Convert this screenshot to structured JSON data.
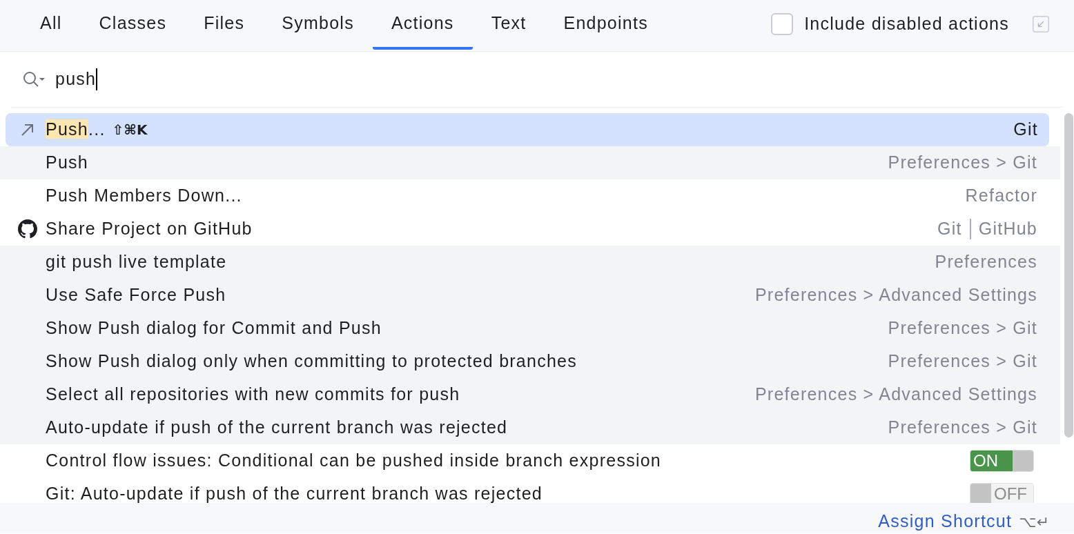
{
  "tabs": [
    {
      "label": "All",
      "selected": false
    },
    {
      "label": "Classes",
      "selected": false
    },
    {
      "label": "Files",
      "selected": false
    },
    {
      "label": "Symbols",
      "selected": false
    },
    {
      "label": "Actions",
      "selected": true
    },
    {
      "label": "Text",
      "selected": false
    },
    {
      "label": "Endpoints",
      "selected": false
    }
  ],
  "include_disabled": {
    "label": "Include disabled actions",
    "checked": false
  },
  "search": {
    "value": "push"
  },
  "results": [
    {
      "kind": "action",
      "label_parts": [
        {
          "text": "Push",
          "highlighted": true
        },
        {
          "text": "...",
          "highlighted": false
        }
      ],
      "shortcut": "⇧⌘K",
      "location": [
        "Git"
      ],
      "selected": true
    },
    {
      "kind": "action",
      "label": "Push",
      "location": [
        "Preferences > Git"
      ],
      "selected": false,
      "shaded": true
    },
    {
      "kind": "action",
      "label": "Push Members Down...",
      "location": [
        "Refactor"
      ],
      "selected": false,
      "shaded": false
    },
    {
      "kind": "action",
      "label": "Share Project on GitHub",
      "location": [
        "Git",
        "GitHub"
      ],
      "selected": false,
      "shaded": false
    },
    {
      "kind": "action",
      "label": "git push live template",
      "location": [
        "Preferences"
      ],
      "selected": false,
      "shaded": true
    },
    {
      "kind": "action",
      "label": "Use Safe Force Push",
      "location": [
        "Preferences > Advanced Settings"
      ],
      "selected": false,
      "shaded": true
    },
    {
      "kind": "action",
      "label": "Show Push dialog for Commit and Push",
      "location": [
        "Preferences > Git"
      ],
      "selected": false,
      "shaded": true
    },
    {
      "kind": "action",
      "label": "Show Push dialog only when committing to protected branches",
      "location": [
        "Preferences > Git"
      ],
      "selected": false,
      "shaded": true
    },
    {
      "kind": "action",
      "label": "Select all repositories with new commits for push",
      "location": [
        "Preferences > Advanced Settings"
      ],
      "selected": false,
      "shaded": true
    },
    {
      "kind": "action",
      "label": "Auto-update if push of the current branch was rejected",
      "location": [
        "Preferences > Git"
      ],
      "selected": false,
      "shaded": true
    },
    {
      "kind": "toggle",
      "label": "Control flow issues: Conditional can be pushed inside branch expression",
      "on": true,
      "toggle_text": "ON",
      "selected": false,
      "shaded": false
    },
    {
      "kind": "toggle",
      "label": "Git: Auto-update if push of the current branch was rejected",
      "on": false,
      "toggle_text": "OFF",
      "selected": false,
      "shaded": false
    }
  ],
  "footer": {
    "link": "Assign Shortcut",
    "shortcut": "⌥↵"
  }
}
